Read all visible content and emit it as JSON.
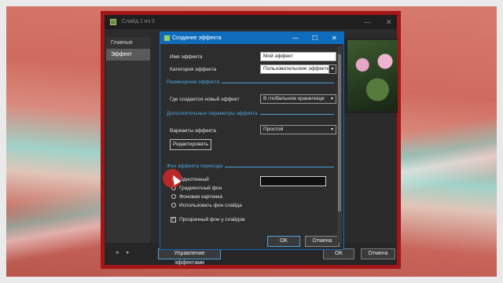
{
  "main_window": {
    "title": "Слайд 1 из 3",
    "controls": {
      "minimize": "—",
      "close": "✕"
    },
    "sidebar": {
      "items": [
        {
          "label": "Главные"
        },
        {
          "label": "Эффект"
        }
      ]
    },
    "bottom": {
      "prev": "◂",
      "next": "▸",
      "manage_label": "Управление эффектами",
      "ok_label": "OK",
      "cancel_label": "Отмена"
    }
  },
  "dialog": {
    "title": "Создание эффекта",
    "controls": {
      "minimize": "—",
      "maximize": "☐",
      "close": "✕"
    },
    "name_label": "Имя эффекта",
    "name_value": "Мой эффект",
    "category_label": "Категория эффекта",
    "category_value": "Пользовательские эффекты",
    "placement_section": "Размещение эффекта",
    "where_label": "Где создается новый эффект",
    "where_value": "В глобальном хранилище",
    "extra_section": "Дополнительные параметры эффекта",
    "variants_label": "Варианты эффекта",
    "variants_value": "Простой",
    "edit_label": "Редактировать",
    "bg_section": "Фон эффекта перехода",
    "bg_options": [
      {
        "label": "Однотонный",
        "selected": true
      },
      {
        "label": "Градиентный фон",
        "selected": false
      },
      {
        "label": "Фоновая картинка",
        "selected": false
      },
      {
        "label": "Использовать фон слайда",
        "selected": false
      }
    ],
    "solid_color": "#111111",
    "transparent_label": "Прозрачный фон у слайдов",
    "transparent_checked": true,
    "ok_label": "OK",
    "cancel_label": "Отмена",
    "dropdown_arrow": "▾"
  }
}
